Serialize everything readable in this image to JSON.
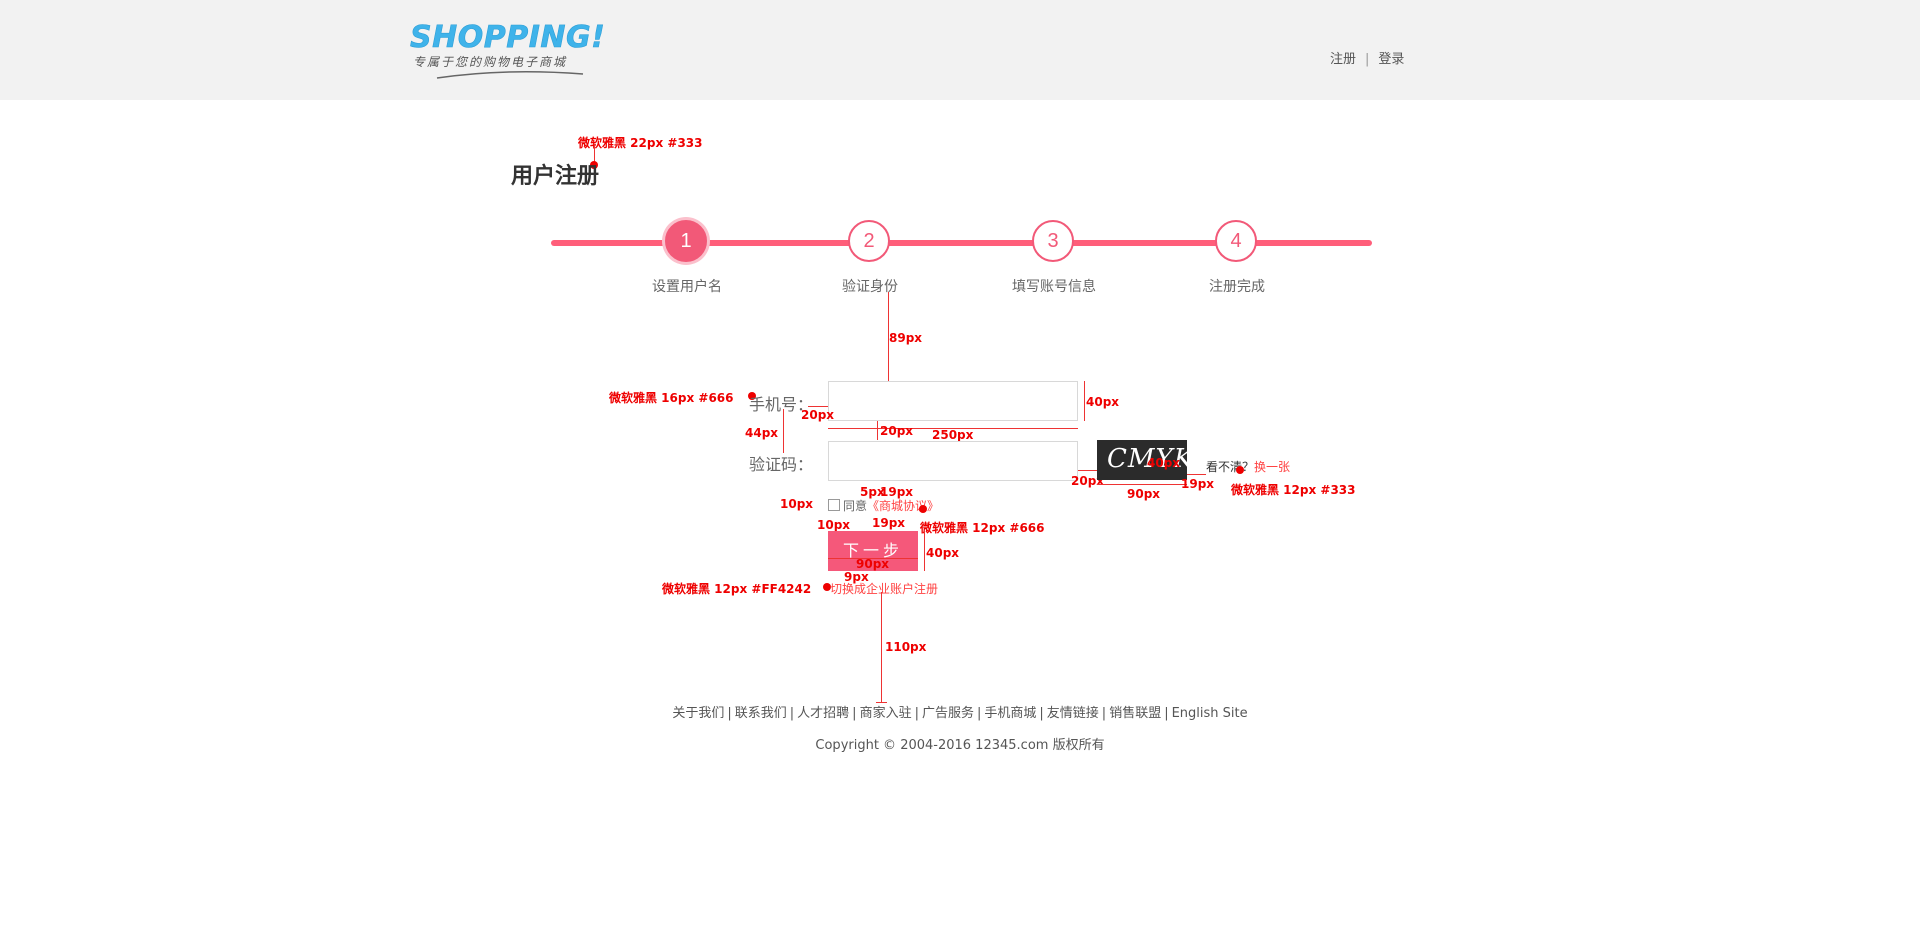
{
  "header": {
    "logo_text": "SHOPPING!",
    "logo_tagline": "专属于您的购物电子商城",
    "register_link": "注册",
    "separator": "|",
    "login_link": "登录"
  },
  "page": {
    "title": "用户注册"
  },
  "steps": [
    {
      "number": "1",
      "label": "设置用户名",
      "active": true
    },
    {
      "number": "2",
      "label": "验证身份",
      "active": false
    },
    {
      "number": "3",
      "label": "填写账号信息",
      "active": false
    },
    {
      "number": "4",
      "label": "注册完成",
      "active": false
    }
  ],
  "form": {
    "phone_label": "手机号：",
    "phone_value": "",
    "code_label": "验证码：",
    "code_value": "",
    "captcha_text": "CMYK",
    "cant_see_text": "看不清？",
    "refresh_link": "换一张",
    "agree_text": "同意",
    "agree_link": "《商城协议》",
    "next_button": "下一步",
    "switch_link": "切换成企业账户注册"
  },
  "annotations": {
    "title_font": "微软雅黑 22px #333",
    "label_font": "微软雅黑 16px #666",
    "captcha_font": "微软雅黑 12px #333",
    "agree_font": "微软雅黑 12px #666",
    "switch_font": "微软雅黑 12px #FF4242",
    "d89": "89px",
    "d40a": "40px",
    "d20a": "20px",
    "d20b": "20px",
    "d250": "250px",
    "d44": "44px",
    "d40b": "40px",
    "d20c": "20px",
    "d90a": "90px",
    "d19a": "19px",
    "d5": "5px",
    "d19b": "19px",
    "d10a": "10px",
    "d10b": "10px",
    "d19c": "19px",
    "d40c": "40px",
    "d90b": "90px",
    "d9": "9px",
    "d110": "110px"
  },
  "footer": {
    "links": [
      "关于我们",
      "联系我们",
      "人才招聘",
      "商家入驻",
      "广告服务",
      "手机商城",
      "友情链接",
      "销售联盟",
      "English Site"
    ],
    "separator": "|",
    "copyright": "Copyright © 2004-2016  12345.com 版权所有"
  },
  "colors": {
    "accent": "#f25978",
    "link_red": "#ff4242",
    "header_bg": "#f2f2f2",
    "annotation_red": "#ee0000"
  }
}
